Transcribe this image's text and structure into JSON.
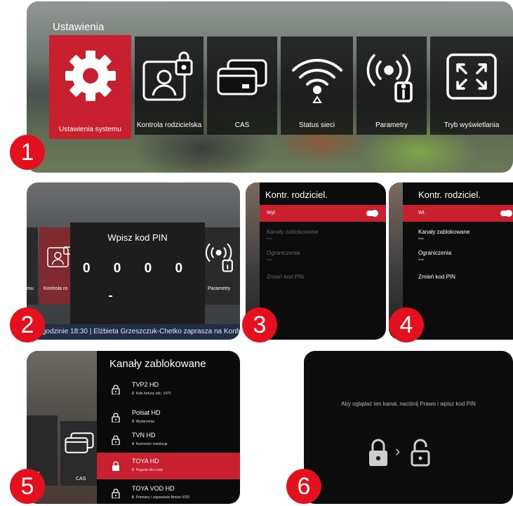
{
  "panel1": {
    "title": "Ustawienia",
    "tiles": [
      {
        "label": "Ustawienia systemu",
        "icon": "gear-icon",
        "selected": true
      },
      {
        "label": "Kontrola rodzicielska",
        "icon": "parental-lock-icon"
      },
      {
        "label": "CAS",
        "icon": "cards-icon"
      },
      {
        "label": "Status sieci",
        "icon": "wifi-icon"
      },
      {
        "label": "Parametry",
        "icon": "broadcast-info-icon"
      },
      {
        "label": "Tryb wyświetlania",
        "icon": "fullscreen-icon"
      }
    ]
  },
  "panel2": {
    "pin_title": "Wpisz kod PIN",
    "pin_digits": "0 0 0 0",
    "tile_left_label": "Kontrola ro",
    "tile_left_partial": "mu",
    "tile_right_label": "Parametry",
    "ticker": "godzinie 18:30    |    Elżbieta Grzeszczuk-Chetko zaprasza na Konfrontacje"
  },
  "panel3": {
    "header": "Kontr. rodziciel.",
    "toggle_label": "Wył.",
    "items": [
      {
        "label": "Kanały zablokowane",
        "sub": "Brak"
      },
      {
        "label": "Ograniczenia",
        "sub": "Brak"
      },
      {
        "label": "Zmień kod PIN",
        "sub": ""
      }
    ]
  },
  "panel4": {
    "header": "Kontr. rodziciel.",
    "toggle_label": "Wł.",
    "items": [
      {
        "label": "Kanały zablokowane",
        "sub": "Brak"
      },
      {
        "label": "Ograniczenia",
        "sub": "Brak"
      },
      {
        "label": "Zmień kod PIN",
        "sub": ""
      }
    ]
  },
  "panel5": {
    "title": "Kanały zablokowane",
    "left_labels": [
      "elska",
      "CAS"
    ],
    "channels": [
      {
        "name": "TVP2 HD",
        "num": "2",
        "program": "Koło fortuny odc. 1475"
      },
      {
        "name": "Polsat HD",
        "num": "3",
        "program": "Wydarzenia"
      },
      {
        "name": "TVN HD",
        "num": "4",
        "program": "Kuchenne rewolucje"
      },
      {
        "name": "TOYA HD",
        "num": "5",
        "program": "Pogoda dla Łodzi",
        "selected": true
      },
      {
        "name": "TOYA VOD HD",
        "num": "6",
        "program": "Premiery i zapowiedzi filmów VOD"
      }
    ]
  },
  "panel6": {
    "message": "Aby oglądać ten kanał, naciśnij Prawo i wpisz kod PIN",
    "arrow": "›"
  },
  "badges": [
    "1",
    "2",
    "3",
    "4",
    "5",
    "6"
  ],
  "colors": {
    "accent": "#c8202f",
    "badge": "#e5101e"
  }
}
